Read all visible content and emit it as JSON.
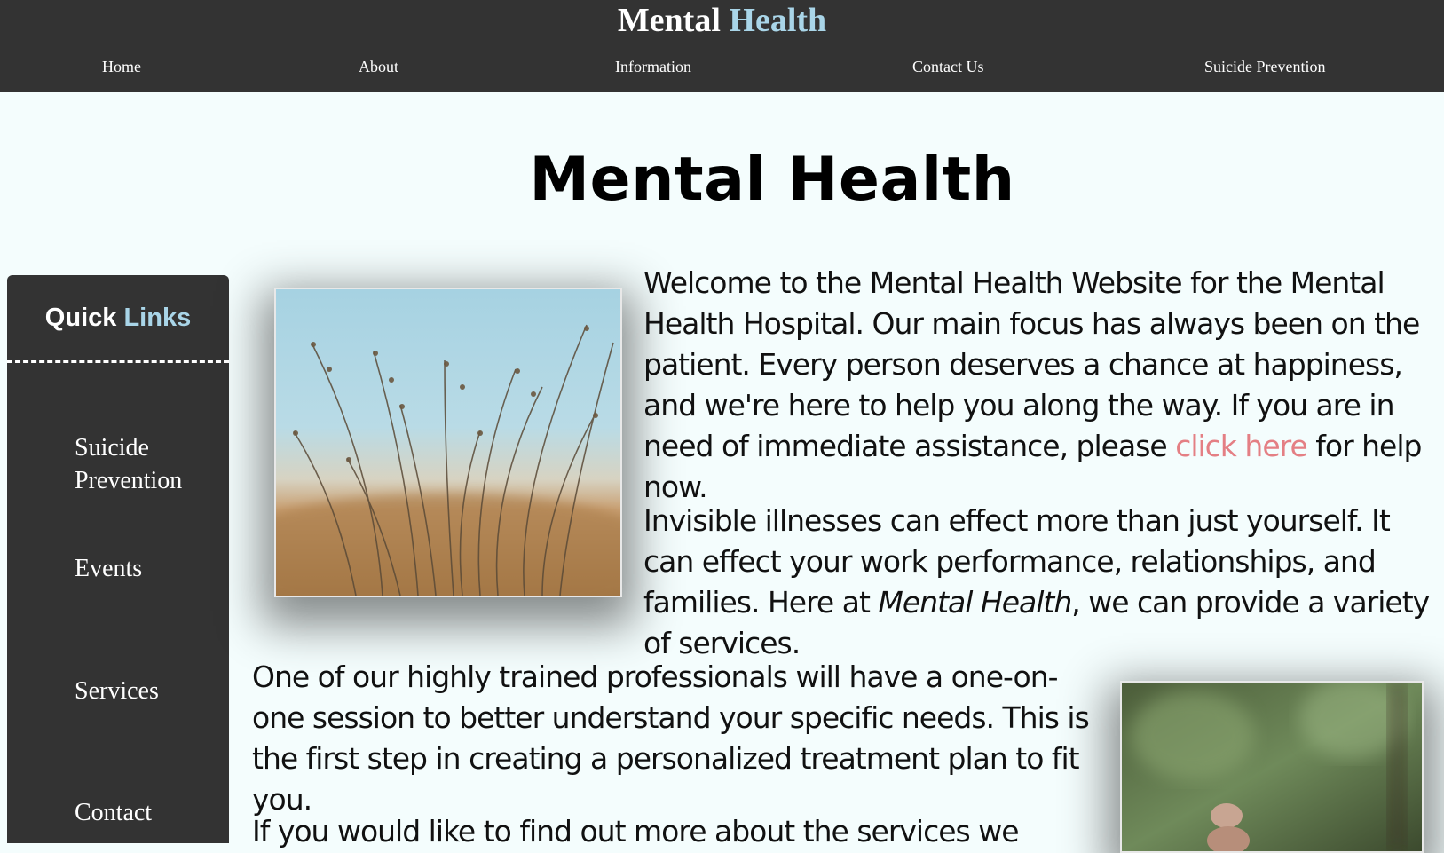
{
  "header": {
    "brand_main": "Mental",
    "brand_accent": "Health",
    "nav": [
      {
        "label": "Home"
      },
      {
        "label": "About"
      },
      {
        "label": "Information"
      },
      {
        "label": "Contact Us"
      },
      {
        "label": "Suicide Prevention"
      }
    ]
  },
  "main": {
    "title": "Mental Health"
  },
  "sidebar": {
    "heading_main": "Quick",
    "heading_accent": "Links",
    "items": [
      {
        "label": "Suicide Prevention"
      },
      {
        "label": "Events"
      },
      {
        "label": "Services"
      },
      {
        "label": "Contact"
      }
    ]
  },
  "content": {
    "p1_before": "Welcome to the Mental Health Website for the Mental Health Hospital. Our main focus has always been on the patient. Every person deserves a chance at happiness, and we're here to help you along the way. If you are in need of immediate assistance, please ",
    "p1_link": "click here",
    "p1_after": " for help now.",
    "p2_before": "Invisible illnesses can effect more than just yourself. It can effect your work performance, relationships, and families. Here at ",
    "p2_em": "Mental Health",
    "p2_after": ", we can provide a variety of services.",
    "p3": "One of our highly trained professionals will have a one-on-one session to better understand your specific needs. This is the first step in creating a personalized treatment plan to fit you.",
    "p4": "If you would like to find out more about the services we"
  },
  "colors": {
    "nav_bg": "#333333",
    "page_bg": "#f4fdfd",
    "accent": "#a9d5e8",
    "link": "#e47f84"
  }
}
